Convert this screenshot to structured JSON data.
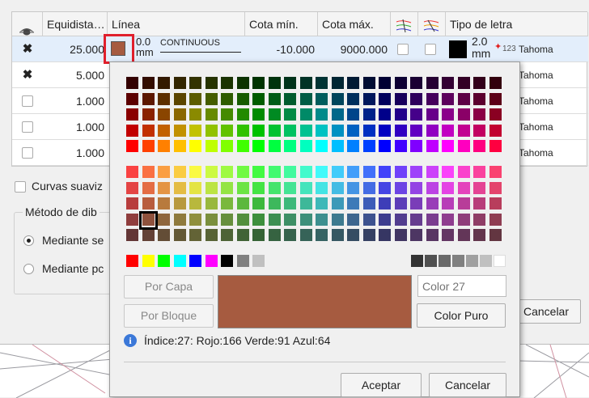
{
  "table": {
    "headers": {
      "eye_icon": "eye-icon",
      "equidistance": "Equidista…",
      "line": "Línea",
      "min_elev": "Cota mín.",
      "max_elev": "Cota máx.",
      "hatch1_icon": "contour-style-icon",
      "hatch2_icon": "contour-label-icon",
      "font": "Tipo de letra"
    },
    "rows": [
      {
        "visible": true,
        "equidistance": "25.000",
        "line_weight_value": "0.0",
        "line_weight_unit": "mm",
        "linetype": "CONTINUOUS",
        "min": "-10.000",
        "max": "9000.000",
        "font_size_value": "2.0",
        "font_size_unit": "mm",
        "font_marker": "123",
        "font": "Tahoma",
        "line_color": "#a65b40"
      },
      {
        "visible": true,
        "equidistance": "5.000",
        "font": "Tahoma"
      },
      {
        "visible": false,
        "equidistance": "1.000",
        "font": "Tahoma"
      },
      {
        "visible": false,
        "equidistance": "1.000",
        "font": "Tahoma"
      },
      {
        "visible": false,
        "equidistance": "1.000",
        "font": "Tahoma"
      }
    ]
  },
  "options": {
    "smooth_curves": "Curvas suaviz",
    "draw_method_legend": "Método de dib",
    "radio1": "Mediante se",
    "radio2": "Mediante pc"
  },
  "dialog_cancel": "Cancelar",
  "color_picker": {
    "by_layer": "Por Capa",
    "by_block": "Por Bloque",
    "color_name_placeholder": "Color 27",
    "pure_color": "Color Puro",
    "info": "Índice:27: Rojo:166 Verde:91 Azul:64",
    "info_icon": "info-icon",
    "accept": "Aceptar",
    "cancel": "Cancelar",
    "selected_color": "#a65b40",
    "selected_index": 27,
    "basic_colors": [
      "#ff0000",
      "#ffff00",
      "#00ff00",
      "#00ffff",
      "#0000ff",
      "#ff00ff",
      "#000000",
      "#808080",
      "#c0c0c0"
    ],
    "gray_colors": [
      "#333333",
      "#505050",
      "#696969",
      "#808080",
      "#a0a0a0",
      "#c0c0c0",
      "#ffffff"
    ]
  }
}
